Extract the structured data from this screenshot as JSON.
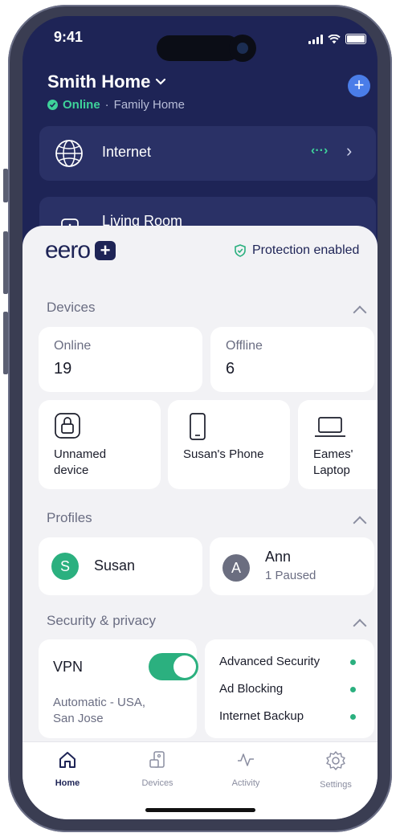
{
  "status_bar": {
    "time": "9:41"
  },
  "header": {
    "home_name": "Smith Home",
    "status": "Online",
    "separator": "·",
    "network_type": "Family Home"
  },
  "network_cards": [
    {
      "label": "Internet",
      "status_glyph": "‹··›"
    },
    {
      "label": "Living Room"
    }
  ],
  "brand": {
    "wordmark": "eero",
    "plus": "+"
  },
  "protection": {
    "label": "Protection enabled"
  },
  "devices": {
    "title": "Devices",
    "online_label": "Online",
    "online_count": "19",
    "offline_label": "Offline",
    "offline_count": "6",
    "items": [
      {
        "name_line1": "Unnamed",
        "name_line2": "device",
        "icon": "lock-icon"
      },
      {
        "name_line1": "Susan's Phone",
        "name_line2": "",
        "icon": "phone-icon"
      },
      {
        "name_line1": "Eames'",
        "name_line2": "Laptop",
        "icon": "laptop-icon"
      }
    ]
  },
  "profiles": {
    "title": "Profiles",
    "items": [
      {
        "initial": "S",
        "name": "Susan",
        "sub": "",
        "color": "#2bb07f"
      },
      {
        "initial": "A",
        "name": "Ann",
        "sub": "1 Paused",
        "color": "#6b6e80"
      }
    ]
  },
  "security": {
    "title": "Security & privacy",
    "vpn_label": "VPN",
    "vpn_enabled": true,
    "vpn_location_line1": "Automatic - USA,",
    "vpn_location_line2": "San Jose",
    "features": [
      "Advanced Security",
      "Ad Blocking",
      "Internet Backup"
    ]
  },
  "tabs": [
    {
      "label": "Home",
      "icon": "home-icon",
      "active": true
    },
    {
      "label": "Devices",
      "icon": "devices-icon",
      "active": false
    },
    {
      "label": "Activity",
      "icon": "activity-icon",
      "active": false
    },
    {
      "label": "Settings",
      "icon": "settings-icon",
      "active": false
    }
  ],
  "colors": {
    "navy": "#1e2456",
    "green": "#2bb07f",
    "accent_blue": "#4a7de8"
  }
}
